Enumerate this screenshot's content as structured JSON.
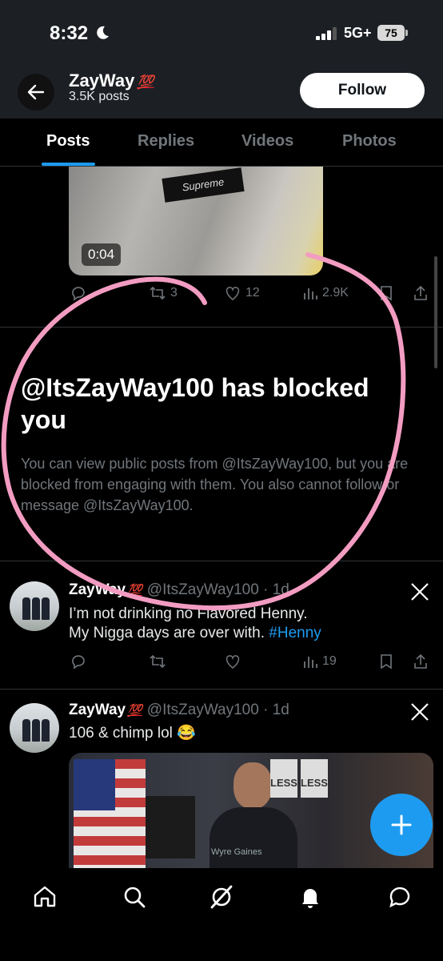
{
  "status_bar": {
    "time": "8:32",
    "network": "5G+",
    "battery": "75",
    "icons": [
      "moon-icon",
      "signal-bars-icon"
    ]
  },
  "header": {
    "name": "ZayWay",
    "name_emoji": "💯",
    "posts_count": "3.5K posts",
    "follow_label": "Follow",
    "icons": [
      "back-arrow-icon"
    ]
  },
  "tabs": [
    {
      "label": "Posts",
      "active": true
    },
    {
      "label": "Replies"
    },
    {
      "label": "Videos"
    },
    {
      "label": "Photos"
    }
  ],
  "first_post": {
    "video_duration": "0:04",
    "media_text": "Supreme",
    "retweets": "3",
    "likes": "12",
    "views": "2.9K"
  },
  "blocked_notice": {
    "title": "@ItsZayWay100 has blocked you",
    "description": "You can view public posts from @ItsZayWay100, but you are blocked from engaging with them. You also cannot follow or message @ItsZayWay100."
  },
  "posts": [
    {
      "author": "ZayWay",
      "author_emoji": "💯",
      "handle": "@ItsZayWay100",
      "time": "1d",
      "text_line1": "I’m not drinking no Flavored Henny.",
      "text_line2": "My Nigga days are over with.",
      "hashtag": "#Henny",
      "views": "19"
    },
    {
      "author": "ZayWay",
      "author_emoji": "💯",
      "handle": "@ItsZayWay100",
      "time": "1d",
      "text": "106 & chimp lol 😂",
      "media_caption": "Wyre Gaines",
      "media_signs": [
        "LESS",
        "LESS"
      ]
    }
  ],
  "bottom_nav": [
    "home-icon",
    "search-icon",
    "grok-icon",
    "notifications-icon",
    "messages-icon"
  ],
  "colors": {
    "accent": "#1d9bf0",
    "annotation": "#f39cc2",
    "background": "#000000",
    "muted_text": "#71767b"
  }
}
